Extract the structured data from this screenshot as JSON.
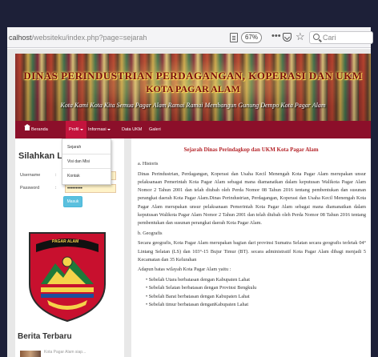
{
  "browser": {
    "url_host": "calhost",
    "url_path": "/websiteku/index.php?page=sejarah",
    "zoom": "67%",
    "search_placeholder": "Cari"
  },
  "banner": {
    "title": "DINAS PERINDUSTRIAN PERDAGANGAN, KOPERASI DAN UKM",
    "city": "KOTA PAGAR ALAM",
    "tagline": "Kota Kami Kota Kita Semua Pagar Alam Ramai Ramai Membangun Gunung Dempo Kota Pagar Alam"
  },
  "nav": {
    "items": [
      {
        "label": "Beranda"
      },
      {
        "label": "Profil"
      },
      {
        "label": "Informasi"
      },
      {
        "label": "Data UKM"
      },
      {
        "label": "Galeri"
      }
    ],
    "dropdown": [
      "Sejarah",
      "Visi dan Misi",
      "Kontak"
    ]
  },
  "login": {
    "title": "Silahkan Lo",
    "username_label": "Username",
    "password_label": "Password",
    "colon": ":",
    "username_value": "admin",
    "password_value": "•••••••••",
    "button": "Masuk"
  },
  "logo": {
    "ribbon_text": "PAGAR ALAM"
  },
  "news": {
    "title": "Berita Terbaru",
    "snippet": "Kota Pagar Alam siap..."
  },
  "article": {
    "title": "Sejarah Dinas Perindagkop dan UKM Kota Pagar Alam",
    "sec_a": "a. Historis",
    "p1": "Dinas Perindustrian, Perdagangan, Koperasi dan Usaha Kecil Menengah Kota Pagar Alam merupakan unsur pelaksanaan Pemerintah Kota Pagar Alam sebagai mana diamanatkan dalam keputusan Walikota Pagar Alam Nomor 2 Tahun 2001 dan telah diubah oleh Perda Nomor 08 Tahun 2016 tentang pembentukan dan susunan perangkat daerah Kota Pagar Alam.Dinas Perindustrian, Perdagangan, Koperasi dan Usaha Kecil Menengah Kota Pagar Alam merupakan unsur pelaksanaan Pemerintah Kota Pagar Alam sebagai mana diamanatkan dalam keputusan Walikota Pagar Alam Nomor 2 Tahun 2001 dan telah diubah oleh Perda Nomor 08 Tahun 2016 tentang pembentukan dan susunan perangkat daerah Kota Pagar Alam.",
    "sec_b": "b. Geografis",
    "p2": "Secara geografis, Kota Pagar Alam merupakan bagian dari provinsi Sumatra Selatan secara geografis terletak 04° Lintang Selatan (LS) dan 103°-15 Bujur Timur (BT). secara administratif Kota Pagar Alam dibagi menjadi 5 Kecamatan dan 35 Kelurahan",
    "p3": "Adapun batas wilayah Kota Pagar Alam yaitu :",
    "borders": [
      "Sebelah Utara berbatasan dengan Kabupaten Lahat",
      "Sebelah Selatan berbatasan dengan Provinsi Bengkulu",
      "Sebelah Barat berbatasan dengan Kabupaten Lahat",
      "Sebelah timur berbatasan denganKabupaten Lahat"
    ]
  }
}
